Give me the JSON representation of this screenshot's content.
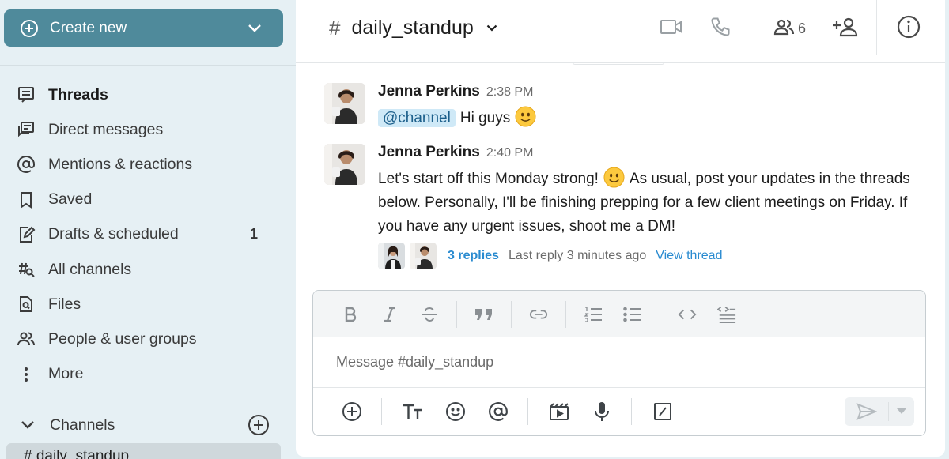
{
  "sidebar": {
    "create_label": "Create new",
    "nav": [
      {
        "label": "Threads",
        "icon": "threads-icon",
        "active": true
      },
      {
        "label": "Direct messages",
        "icon": "direct-messages-icon"
      },
      {
        "label": "Mentions & reactions",
        "icon": "at-sign-icon"
      },
      {
        "label": "Saved",
        "icon": "bookmark-icon"
      },
      {
        "label": "Drafts & scheduled",
        "icon": "draft-icon",
        "count": "1"
      },
      {
        "label": "All channels",
        "icon": "channel-search-icon"
      },
      {
        "label": "Files",
        "icon": "file-search-icon"
      },
      {
        "label": "People & user groups",
        "icon": "people-icon"
      },
      {
        "label": "More",
        "icon": "more-vertical-icon"
      }
    ],
    "channels_label": "Channels",
    "channel_peek": "# daily_standup"
  },
  "header": {
    "hash": "#",
    "channel_name": "daily_standup",
    "member_count": "6"
  },
  "messages": [
    {
      "author": "Jenna Perkins",
      "time": "2:38 PM",
      "mention": "@channel",
      "text": "Hi guys"
    },
    {
      "author": "Jenna Perkins",
      "time": "2:40 PM",
      "text_part1": "Let's start off this Monday strong!",
      "text_part2": "As usual, post your updates in the threads below. Personally, I'll be finishing prepping for a few client meetings on Friday. If you have any urgent issues, shoot me a DM!",
      "replies": "3 replies",
      "last_reply": "Last reply 3 minutes ago",
      "view_thread": "View thread"
    }
  ],
  "composer": {
    "placeholder": "Message #daily_standup"
  },
  "colors": {
    "accent": "#4f8a9b",
    "link": "#2a8bd0",
    "mention_bg": "#cfe9f7"
  }
}
